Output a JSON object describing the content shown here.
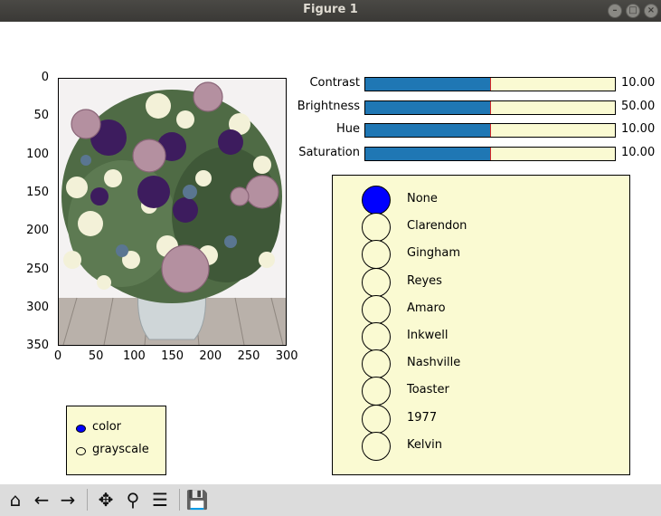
{
  "window": {
    "title": "Figure 1",
    "controls": [
      "minimize",
      "maximize",
      "close"
    ]
  },
  "image_axes": {
    "y_ticks": [
      "0",
      "50",
      "100",
      "150",
      "200",
      "250",
      "300",
      "350"
    ],
    "x_ticks": [
      "0",
      "50",
      "100",
      "150",
      "200",
      "250",
      "300"
    ],
    "image": "flower-bouquet-in-glass-vase"
  },
  "sliders": [
    {
      "label": "Contrast",
      "value_text": "10.00",
      "fill": 0.5
    },
    {
      "label": "Brightness",
      "value_text": "50.00",
      "fill": 0.5
    },
    {
      "label": "Hue",
      "value_text": "10.00",
      "fill": 0.5
    },
    {
      "label": "Saturation",
      "value_text": "10.00",
      "fill": 0.5
    }
  ],
  "filters": {
    "selected": "None",
    "options": [
      "None",
      "Clarendon",
      "Gingham",
      "Reyes",
      "Amaro",
      "Inkwell",
      "Nashville",
      "Toaster",
      "1977",
      "Kelvin"
    ]
  },
  "mode": {
    "selected": "color",
    "options": [
      "color",
      "grayscale"
    ]
  },
  "toolbar": {
    "buttons": [
      "home-icon",
      "back-arrow-icon",
      "forward-arrow-icon",
      "pan-icon",
      "zoom-icon",
      "configure-subplots-icon",
      "save-icon"
    ]
  },
  "colors": {
    "slider_fill": "#1f77b4",
    "slider_marker": "#d62728",
    "widget_bg": "#fafad2",
    "radio_on": "#0000ff"
  }
}
